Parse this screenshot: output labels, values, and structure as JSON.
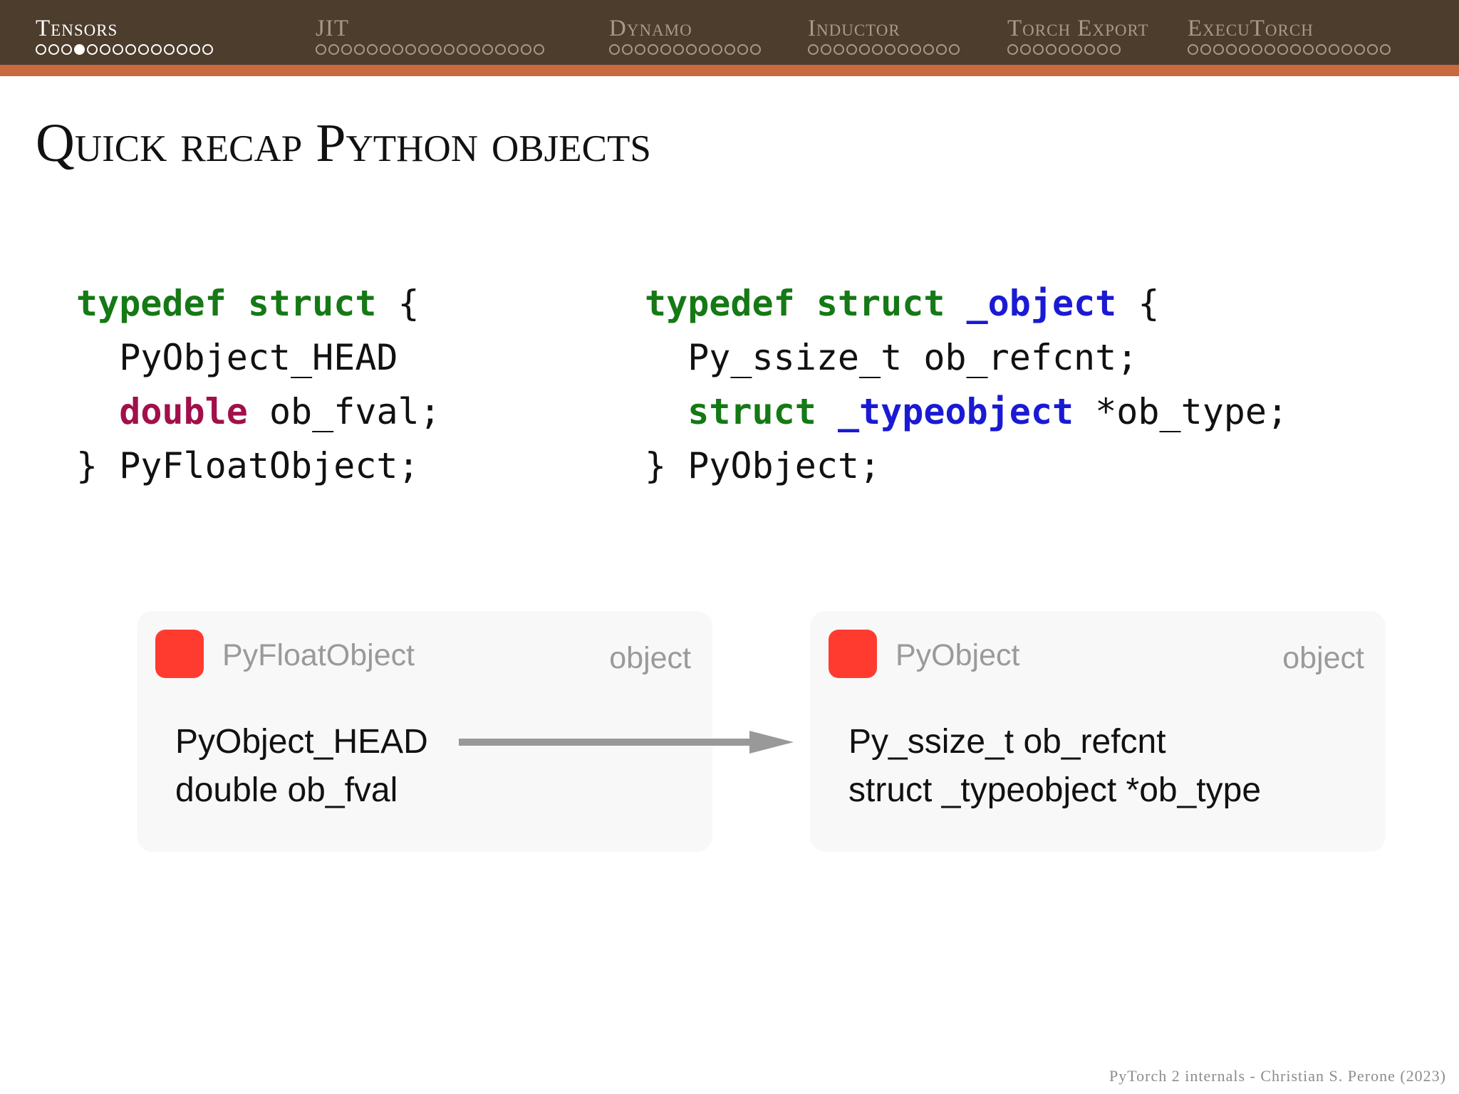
{
  "nav": {
    "sections": [
      {
        "title": "Tensors",
        "dots": 14,
        "current_dot": 3
      },
      {
        "title": "JIT",
        "dots": 18,
        "current_dot": null
      },
      {
        "title": "Dynamo",
        "dots": 12,
        "current_dot": null
      },
      {
        "title": "Inductor",
        "dots": 12,
        "current_dot": null
      },
      {
        "title": "Torch Export",
        "dots": 9,
        "current_dot": null
      },
      {
        "title": "ExecuTorch",
        "dots": 16,
        "current_dot": null
      }
    ],
    "active_section": 0
  },
  "slide": {
    "title": "Quick recap Python objects"
  },
  "code_left": {
    "l1_kw1": "typedef",
    "l1_kw2": "struct",
    "l1_rest": " {",
    "l2": "  PyObject_HEAD",
    "l3_type": "double",
    "l3_rest": " ob_fval;",
    "l4": "} PyFloatObject;"
  },
  "code_right": {
    "l1_kw1": "typedef",
    "l1_kw2": "struct",
    "l1_name": "_object",
    "l1_rest": " {",
    "l2": "  Py_ssize_t ob_refcnt;",
    "l3_kw": "struct",
    "l3_name": "_typeobject",
    "l3_rest": " *ob_type;",
    "l4": "} PyObject;"
  },
  "diagram": {
    "left_box": {
      "name": "PyFloatObject",
      "kind": "object",
      "fields": [
        "PyObject_HEAD",
        "double ob_fval"
      ]
    },
    "right_box": {
      "name": "PyObject",
      "kind": "object",
      "fields": [
        "Py_ssize_t ob_refcnt",
        "struct _typeobject *ob_type"
      ]
    }
  },
  "footer": {
    "text": "PyTorch 2 internals - Christian S. Perone (2023)"
  },
  "colors": {
    "nav_bg": "#4d3d2d",
    "nav_accent": "#c86a40",
    "keyword": "#157915",
    "type": "#a0104a",
    "identifier": "#1a1ad4",
    "box_icon": "#ff3b30"
  }
}
